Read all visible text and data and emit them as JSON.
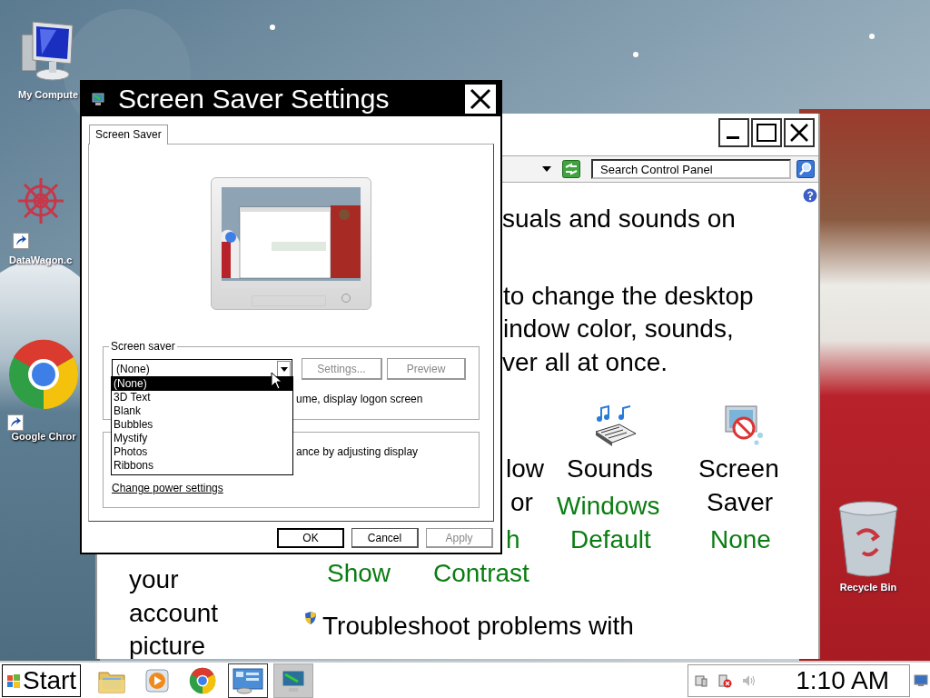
{
  "desktop": {
    "icons": [
      {
        "kind": "computer",
        "label": "My Compute",
        "shortcut": false
      },
      {
        "kind": "app",
        "label": "DataWagon.c",
        "shortcut": true
      },
      {
        "kind": "chrome",
        "label": "Google Chror",
        "shortcut": true
      },
      {
        "kind": "recycle",
        "label": "Recycle Bin",
        "shortcut": false
      }
    ]
  },
  "control_panel": {
    "search": {
      "placeholder": "Search Control Panel"
    },
    "fragments": [
      {
        "kind": "text",
        "text": "suals and sounds on"
      },
      {
        "kind": "text",
        "text": "to change the desktop"
      },
      {
        "kind": "text",
        "text": "indow color, sounds,"
      },
      {
        "kind": "text",
        "text": "ver all at once."
      },
      {
        "kind": "text",
        "text": "low"
      },
      {
        "kind": "text",
        "text": "or"
      },
      {
        "kind": "value",
        "text": "h"
      },
      {
        "kind": "value",
        "text": "Show"
      },
      {
        "kind": "value",
        "text": "Contrast"
      },
      {
        "kind": "text",
        "text": "Sounds"
      },
      {
        "kind": "value",
        "text": "Windows"
      },
      {
        "kind": "value",
        "text": "Default"
      },
      {
        "kind": "text",
        "text": "Screen"
      },
      {
        "kind": "text",
        "text": "Saver"
      },
      {
        "kind": "value",
        "text": "None"
      },
      {
        "kind": "text",
        "text": "Troubleshoot problems with"
      }
    ],
    "sidebar_link": "your account picture"
  },
  "dialog": {
    "title": "Screen Saver Settings",
    "tabs": [
      {
        "label": "Screen Saver",
        "selected": true
      }
    ],
    "screen_saver_group": {
      "label": "Screen saver",
      "combo_value": "(None)",
      "options": [
        {
          "label": "(None)",
          "selected": true
        },
        {
          "label": "3D Text",
          "selected": false
        },
        {
          "label": "Blank",
          "selected": false
        },
        {
          "label": "Bubbles",
          "selected": false
        },
        {
          "label": "Mystify",
          "selected": false
        },
        {
          "label": "Photos",
          "selected": false
        },
        {
          "label": "Ribbons",
          "selected": false
        }
      ],
      "buttons": [
        {
          "label": "Settings...",
          "disabled": true
        },
        {
          "label": "Preview",
          "disabled": true
        }
      ],
      "text": "ume, display logon screen"
    },
    "power_group": {
      "text": "ance by adjusting display",
      "link": "Change power settings"
    },
    "buttons": [
      {
        "label": "OK",
        "disabled": false,
        "default": true
      },
      {
        "label": "Cancel",
        "disabled": false,
        "default": false
      },
      {
        "label": "Apply",
        "disabled": true,
        "default": false
      }
    ]
  },
  "taskbar": {
    "start": "Start",
    "apps": [
      {
        "kind": "folder",
        "open": false,
        "selected": false
      },
      {
        "kind": "media",
        "open": false,
        "selected": false
      },
      {
        "kind": "chrome",
        "open": false,
        "selected": false
      },
      {
        "kind": "control",
        "open": true,
        "selected": false
      },
      {
        "kind": "monitor",
        "open": true,
        "selected": true
      }
    ],
    "clock": "1:10 AM"
  }
}
